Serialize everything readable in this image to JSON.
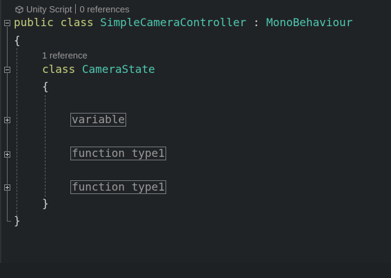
{
  "codelens_top": {
    "icon": "unity-cube-icon",
    "script_label": "Unity Script",
    "references": "0 references"
  },
  "class_decl": {
    "kw_public": "public",
    "kw_class": "class",
    "name": "SimpleCameraController",
    "colon": ":",
    "base": "MonoBehaviour"
  },
  "open_brace_outer": "{",
  "codelens_inner": {
    "references": "1 reference"
  },
  "inner_class_decl": {
    "kw_class": "class",
    "name": "CameraState"
  },
  "open_brace_inner": "{",
  "collapsed_regions": [
    {
      "label": "variable"
    },
    {
      "label": "function type1"
    },
    {
      "label": "function type1"
    }
  ],
  "close_brace_inner": "}",
  "close_brace_outer": "}",
  "colors": {
    "background": "#202326",
    "keyword": "#c3d17c",
    "type": "#4ec9b0",
    "codelens": "#9a9a9a"
  }
}
